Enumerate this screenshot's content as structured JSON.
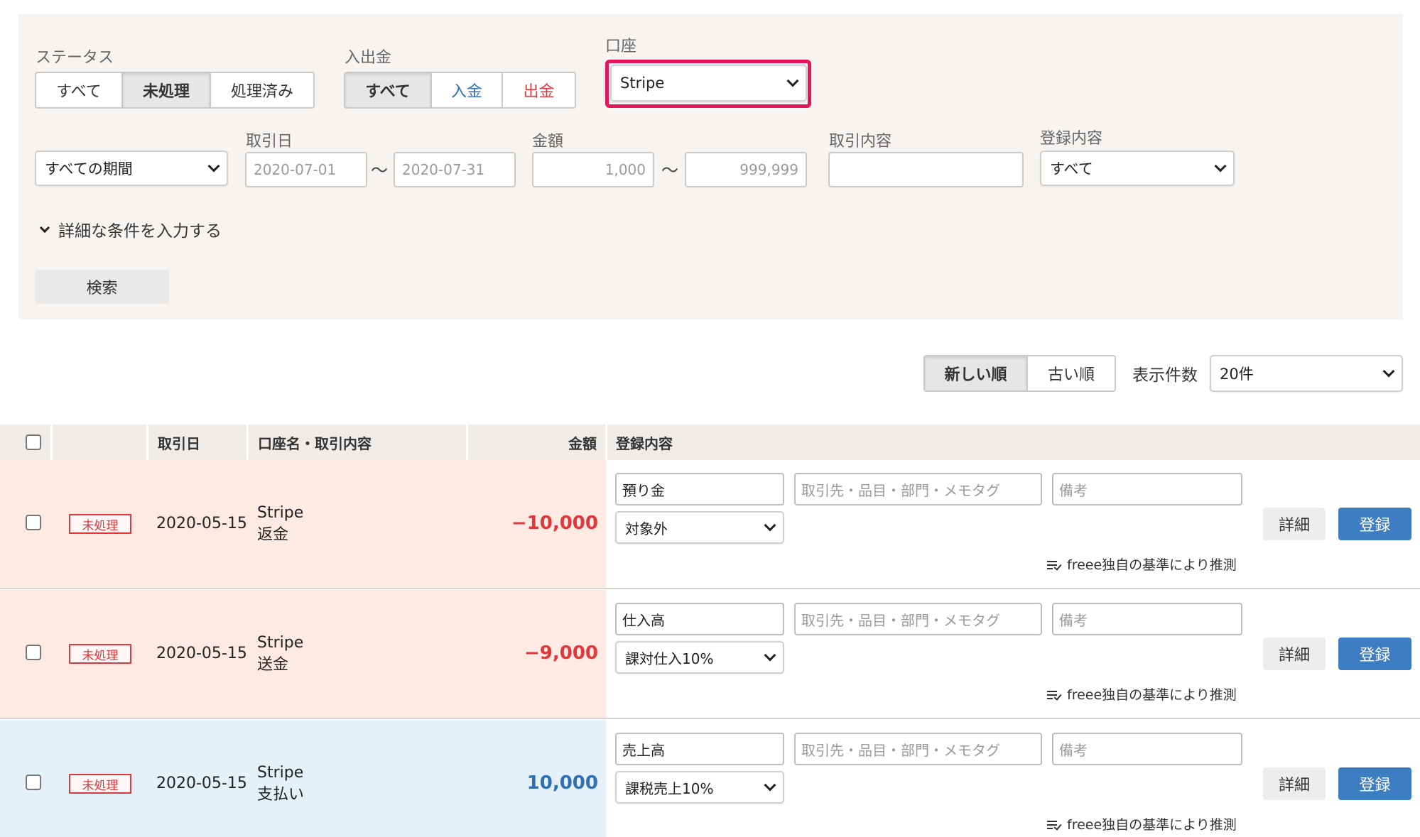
{
  "filters": {
    "status": {
      "label": "ステータス",
      "options": [
        "すべて",
        "未処理",
        "処理済み"
      ],
      "active": 1
    },
    "inout": {
      "label": "入出金",
      "options": [
        "すべて",
        "入金",
        "出金"
      ],
      "active": 0
    },
    "account": {
      "label": "口座",
      "value": "Stripe"
    },
    "period": {
      "value": "すべての期間"
    },
    "date": {
      "label": "取引日",
      "from": "2020-07-01",
      "to": "2020-07-31",
      "tilde": "〜"
    },
    "amount": {
      "label": "金額",
      "from": "1,000",
      "to": "999,999",
      "tilde": "〜"
    },
    "description": {
      "label": "取引内容",
      "value": ""
    },
    "registration": {
      "label": "登録内容",
      "value": "すべて"
    },
    "details_toggle": "詳細な条件を入力する",
    "search_button": "検索"
  },
  "sort": {
    "options": [
      "新しい順",
      "古い順"
    ],
    "active": 0
  },
  "page_size": {
    "label": "表示件数",
    "value": "20件"
  },
  "table": {
    "headers": {
      "date": "取引日",
      "account": "口座名・取引内容",
      "amount": "金額",
      "registration": "登録内容"
    },
    "rows": [
      {
        "status": "未処理",
        "date": "2020-05-15",
        "account": "Stripe",
        "description": "返金",
        "amount": "−10,000",
        "account_item": "預り金",
        "partner_placeholder": "取引先・品目・部門・メモタグ",
        "memo_placeholder": "備考",
        "tax": "対象外",
        "guess": "freee独自の基準により推測",
        "detail": "詳細",
        "register": "登録"
      },
      {
        "status": "未処理",
        "date": "2020-05-15",
        "account": "Stripe",
        "description": "送金",
        "amount": "−9,000",
        "account_item": "仕入高",
        "partner_placeholder": "取引先・品目・部門・メモタグ",
        "memo_placeholder": "備考",
        "tax": "課対仕入10%",
        "guess": "freee独自の基準により推測",
        "detail": "詳細",
        "register": "登録"
      },
      {
        "status": "未処理",
        "date": "2020-05-15",
        "account": "Stripe",
        "description": "支払い",
        "amount": "10,000",
        "account_item": "売上高",
        "partner_placeholder": "取引先・品目・部門・メモタグ",
        "memo_placeholder": "備考",
        "tax": "課税売上10%",
        "guess": "freee独自の基準により推測",
        "detail": "詳細",
        "register": "登録"
      }
    ]
  },
  "colors": {
    "accent_blue": "#3d7dc2",
    "negative_red": "#e0363c",
    "highlight": "#e4155c"
  }
}
